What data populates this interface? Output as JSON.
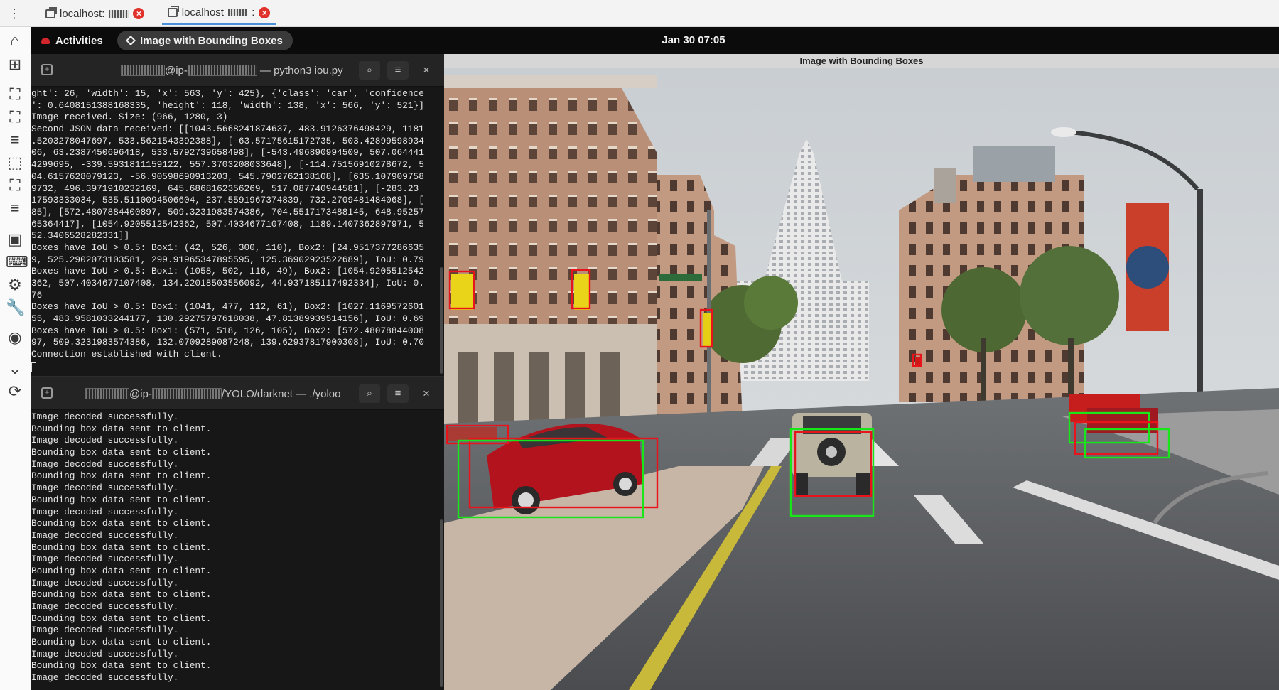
{
  "browser": {
    "menu_icon": "vertical-dots-icon",
    "tabs": [
      {
        "label": "localhost:",
        "active": false
      },
      {
        "label": "localhost",
        "suffix": ":",
        "active": true
      }
    ]
  },
  "topbar": {
    "activities_label": "Activities",
    "app_label": "Image with Bounding Boxes",
    "clock": "Jan 30  07:05"
  },
  "dock": {
    "icons": [
      "home-icon",
      "new-window-icon",
      "screenshot-icon",
      "fullscreen-icon",
      "menu-icon",
      "region-icon",
      "fit-icon",
      "list-icon",
      "display-icon",
      "keyboard-icon",
      "settings-icon",
      "wrench-icon",
      "camera-icon",
      "chevron-down-icon",
      "reconnect-icon"
    ]
  },
  "terminal_top": {
    "title_part1": "@ip-",
    "title_part2": "— python3 iou.py",
    "lines": [
      "ght': 26, 'width': 15, 'x': 563, 'y': 425}, {'class': 'car', 'confidence",
      "': 0.6408151388168335, 'height': 118, 'width': 138, 'x': 566, 'y': 521}]",
      "Image received. Size: (966, 1280, 3)",
      "Second JSON data received: [[1043.5668241874637, 483.9126376498429, 1181",
      ".5203278047697, 533.5621543392388], [-63.57175615172735, 503.42899598934",
      "06, 63.2387450696418, 533.5792739658498], [-543.496890994509, 507.064441",
      "4299695, -339.5931811159122, 557.3703208033648], [-114.75156910278672, 5",
      "04.6157628079123, -56.90598690913203, 545.7902762138108], [635.107909758",
      "9732, 496.3971910232169, 645.6868162356269, 517.087740944581], [-283.23",
      "17593333034, 535.5110094506604, 237.5591967374839, 732.2709481484068], [",
      "85], [572.4807884400897, 509.3231983574386, 704.5517173488145, 648.95257",
      "65364417], [1054.9205512542362, 507.4034677107408, 1189.1407362897971, 5",
      "52.3406528282331]]",
      "Boxes have IoU > 0.5: Box1: (42, 526, 300, 110), Box2: [24.9517377286635",
      "9, 525.2902073103581, 299.91965347895595, 125.36902923522689], IoU: 0.79",
      "Boxes have IoU > 0.5: Box1: (1058, 502, 116, 49), Box2: [1054.9205512542",
      "362, 507.4034677107408, 134.22018503556092, 44.937185117492334], IoU: 0.",
      "76",
      "Boxes have IoU > 0.5: Box1: (1041, 477, 112, 61), Box2: [1027.1169572601",
      "55, 483.9581033244177, 130.29275797618038, 47.81389939514156], IoU: 0.69",
      "Boxes have IoU > 0.5: Box1: (571, 518, 126, 105), Box2: [572.48078844008",
      "97, 509.3231983574386, 132.0709289087248, 139.62937817900308], IoU: 0.70",
      "Connection established with client."
    ]
  },
  "terminal_bottom": {
    "title_part1": "@ip-",
    "title_part2": "/YOLO/darknet — ./yoloo",
    "lines": [
      "Image decoded successfully.",
      "Bounding box data sent to client.",
      "Image decoded successfully.",
      "Bounding box data sent to client.",
      "Image decoded successfully.",
      "Bounding box data sent to client.",
      "Image decoded successfully.",
      "Bounding box data sent to client.",
      "Image decoded successfully.",
      "Bounding box data sent to client.",
      "Image decoded successfully.",
      "Bounding box data sent to client.",
      "Image decoded successfully.",
      "Bounding box data sent to client.",
      "Image decoded successfully.",
      "Bounding box data sent to client.",
      "Image decoded successfully.",
      "Bounding box data sent to client.",
      "Image decoded successfully.",
      "Bounding box data sent to client.",
      "Image decoded successfully.",
      "Bounding box data sent to client.",
      "Image decoded successfully."
    ]
  },
  "image_window": {
    "title": "Image with Bounding Boxes",
    "box_colors": {
      "red": "#e8141c",
      "green": "#19e619"
    }
  },
  "colors": {
    "terminal_bg": "#171717",
    "topbar_bg": "#0b0b0b",
    "accent": "#4a90d9",
    "close_red": "#e0322a"
  }
}
